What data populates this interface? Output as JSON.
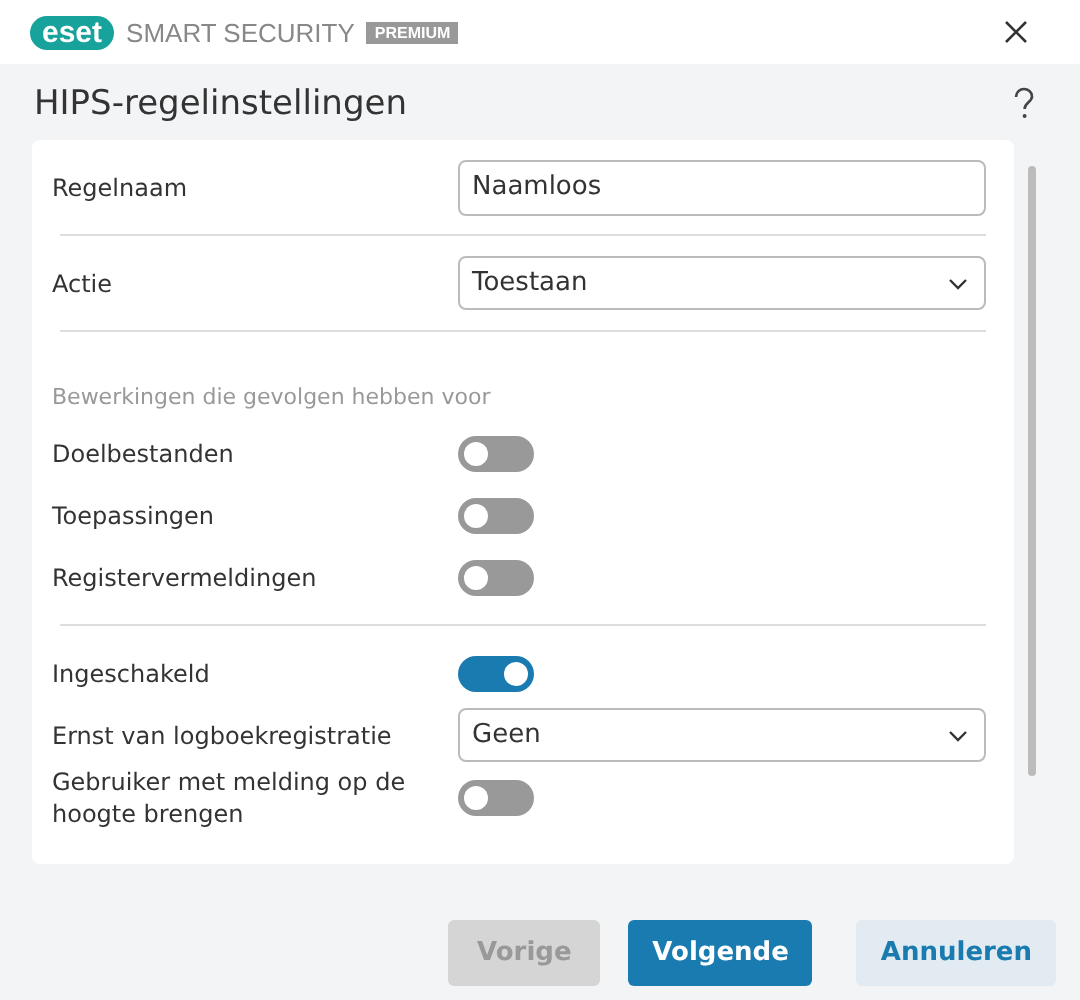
{
  "window": {
    "brand": "eset",
    "product": "SMART SECURITY",
    "edition": "PREMIUM"
  },
  "title": "HIPS-regelinstellingen",
  "groups": [
    {
      "rows": [
        {
          "kind": "input",
          "label": "Regelnaam",
          "value": "Naamloos"
        }
      ]
    },
    {
      "rows": [
        {
          "kind": "select",
          "label": "Actie",
          "value": "Toestaan"
        }
      ]
    },
    {
      "rows": [
        {
          "kind": "heading",
          "label": "Bewerkingen die gevolgen hebben voor"
        },
        {
          "kind": "toggle",
          "label": "Doelbestanden",
          "on": false
        },
        {
          "kind": "toggle",
          "label": "Toepassingen",
          "on": false
        },
        {
          "kind": "toggle",
          "label": "Registervermeldingen",
          "on": false
        }
      ]
    },
    {
      "rows": [
        {
          "kind": "toggle",
          "label": "Ingeschakeld",
          "on": true
        },
        {
          "kind": "select",
          "label": "Ernst van logboekregistratie",
          "value": "Geen"
        },
        {
          "kind": "toggle",
          "label": "Gebruiker met melding op de hoogte brengen",
          "on": false
        }
      ]
    }
  ],
  "buttons": [
    {
      "label": "Vorige",
      "kind": "secondary",
      "disabled": true
    },
    {
      "label": "Volgende",
      "kind": "primary",
      "disabled": false
    },
    {
      "label": "Annuleren",
      "kind": "tertiary",
      "disabled": false
    }
  ]
}
